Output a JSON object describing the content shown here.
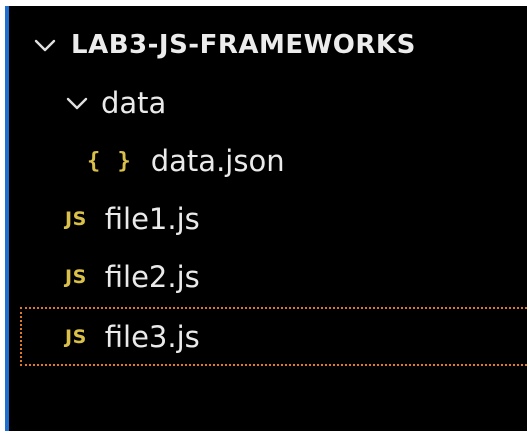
{
  "explorer": {
    "project": {
      "label": "LAB3-JS-FRAMEWORKS",
      "expanded": true,
      "chevron_icon": "chevron-down-icon"
    },
    "folder": {
      "label": "data",
      "expanded": true,
      "chevron_icon": "chevron-down-icon"
    },
    "files": [
      {
        "icon": "json-file-icon",
        "icon_text": "{ }",
        "label": "data.json",
        "icon_color": "#d8c04a"
      },
      {
        "icon": "js-file-icon",
        "icon_text": "JS",
        "label": "file1.js",
        "icon_color": "#d8c04a"
      },
      {
        "icon": "js-file-icon",
        "icon_text": "JS",
        "label": "file2.js",
        "icon_color": "#d8c04a"
      },
      {
        "icon": "js-file-icon",
        "icon_text": "JS",
        "label": "file3.js",
        "icon_color": "#d8c04a",
        "focused": true
      }
    ]
  },
  "colors": {
    "background": "#000000",
    "text": "#eaeaea",
    "accent_border": "#1f6fd1",
    "focus_outline": "#e0782a",
    "icon": "#d8c04a"
  }
}
